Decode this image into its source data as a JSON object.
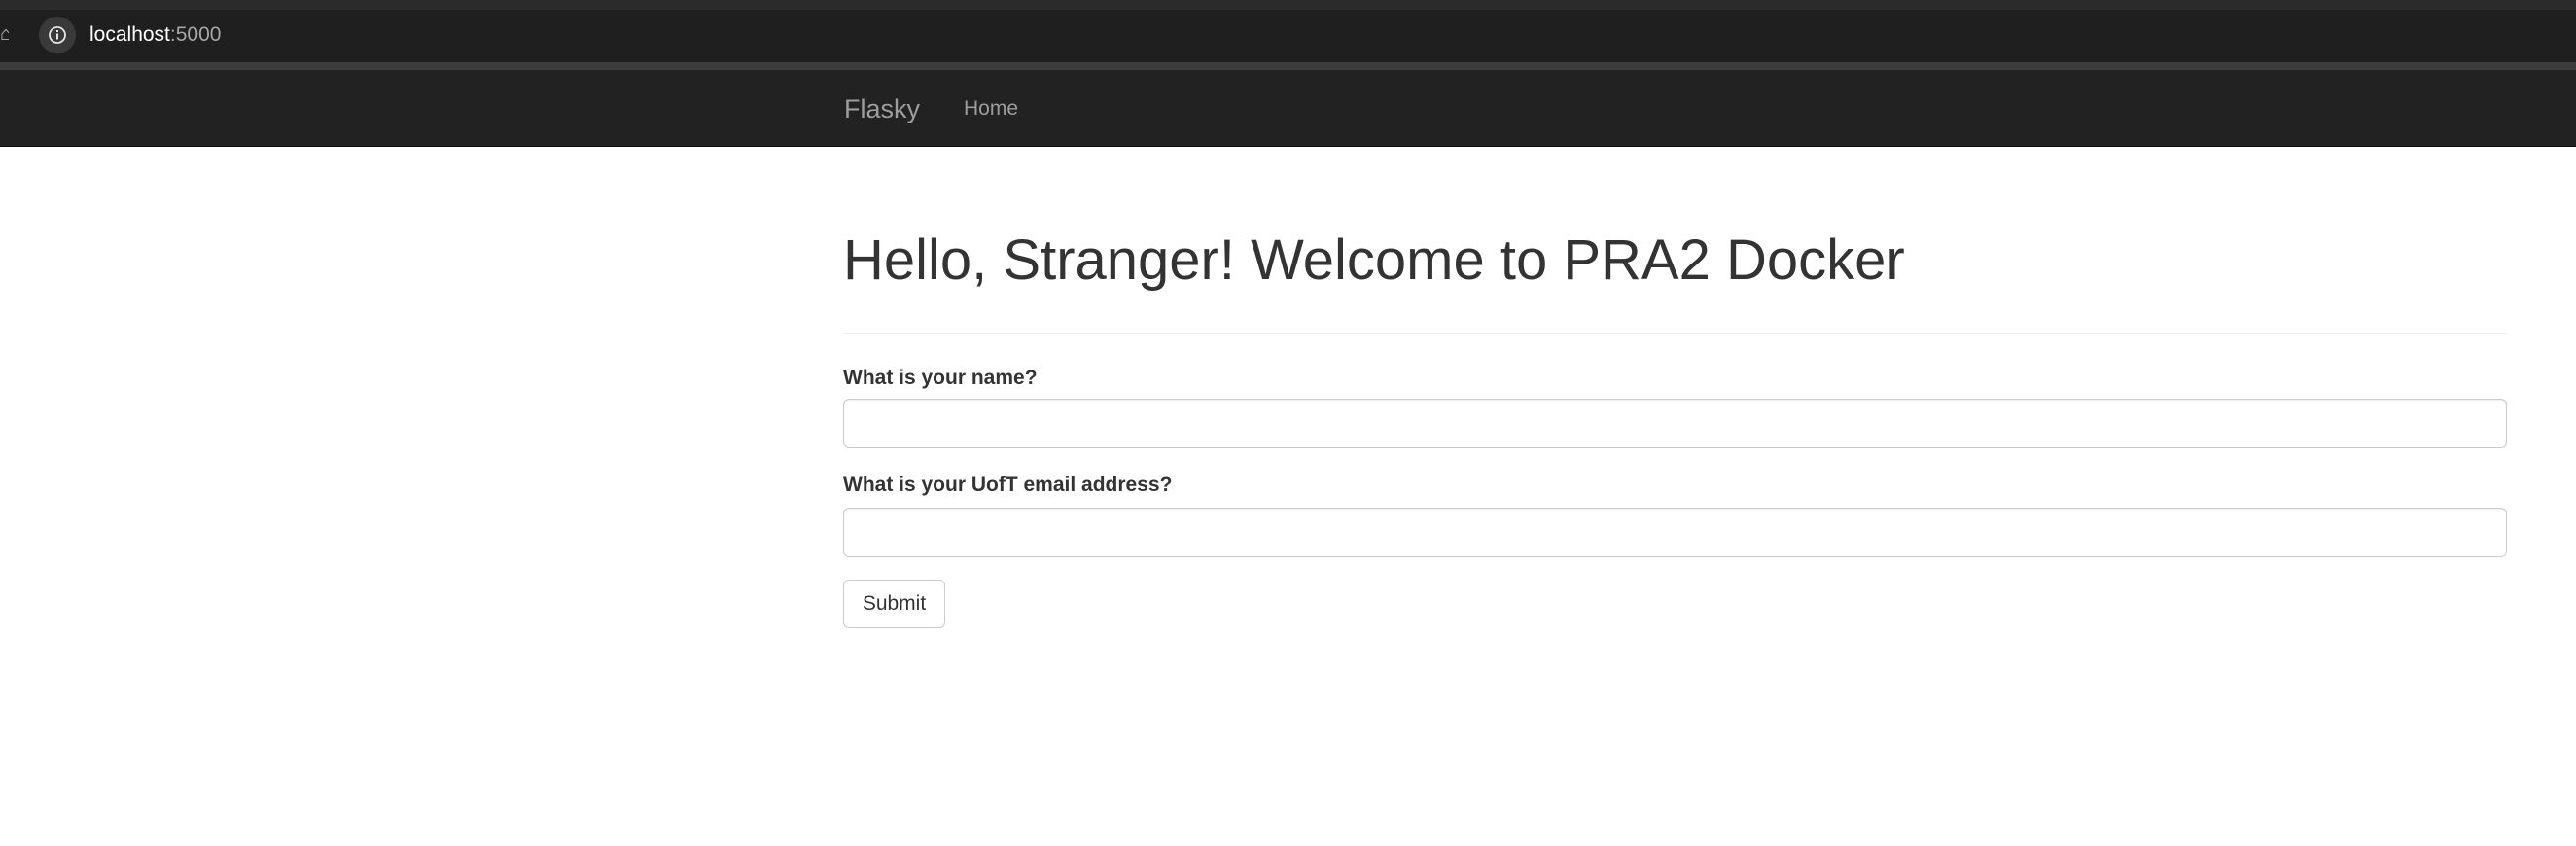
{
  "browser": {
    "url_host": "localhost",
    "url_port": ":5000",
    "icons": [
      "home-icon",
      "info-icon"
    ]
  },
  "navbar": {
    "brand": "Flasky",
    "links": [
      {
        "label": "Home"
      }
    ],
    "background": "#222222",
    "link_color": "#9d9d9d"
  },
  "main": {
    "title": "Hello, Stranger! Welcome to PRA2 Docker",
    "form": {
      "name_label": "What is your name?",
      "name_value": "",
      "email_label": "What is your UofT email address?",
      "email_value": "",
      "submit_label": "Submit"
    }
  }
}
